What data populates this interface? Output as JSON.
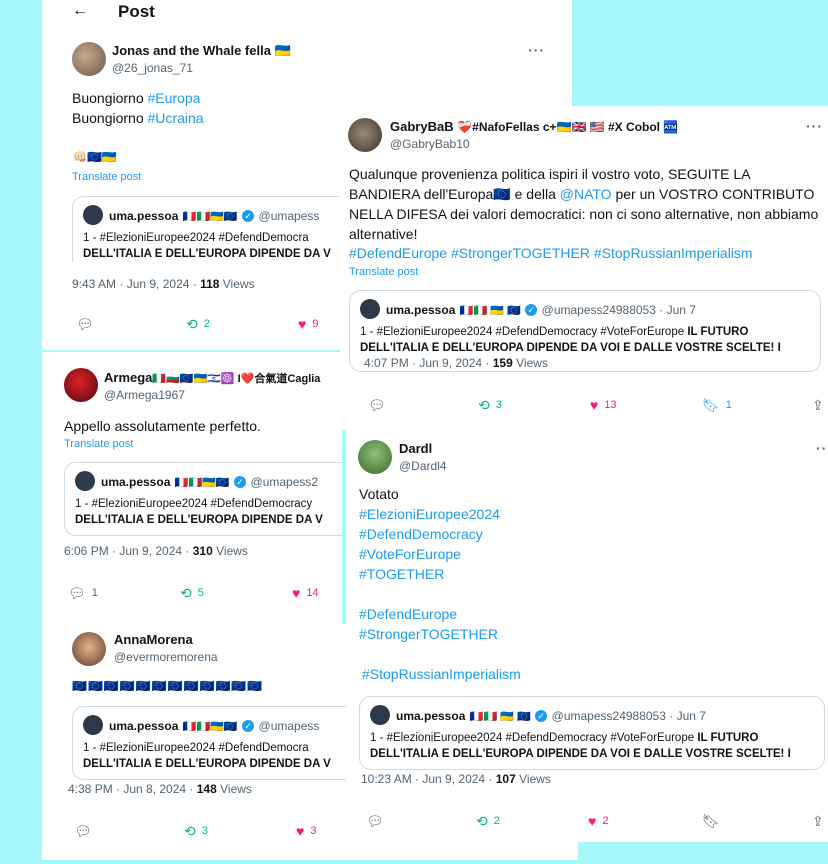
{
  "header": {
    "back_icon": "arrow-left-icon",
    "title": "Post"
  },
  "post1": {
    "author": "Jonas and the Whale fella",
    "author_flags": "🇺🇦",
    "handle": "@26_jonas_71",
    "line1_prefix": "Buongiorno ",
    "line1_tag": "#Europa",
    "line2_prefix": "Buongiorno ",
    "line2_tag": "#Ucraina",
    "emoji_line": "👊🏻🇪🇺🇺🇦",
    "translate": "Translate post",
    "quote": {
      "name": "uma.pessoa",
      "flags": "🇫🇷🇮🇹🇺🇦🇪🇺",
      "handle": "@umapess",
      "line1": "1 -  #ElezioniEuropee2024 #DefendDemocra",
      "line2": "DELL'ITALIA E DELL'EUROPA DIPENDE DA V"
    },
    "meta_time": "9:43 AM · Jun 9, 2024 · ",
    "views_num": "118",
    "views_label": " Views",
    "retweets": "2",
    "likes": "9"
  },
  "post2": {
    "author": "GabryBaB",
    "author_suffix": "❤️‍🩹#NafoFellas c+🇺🇦🇬🇧 🇺🇸 #X Cobol 🏧",
    "handle": "@GabryBab10",
    "text": "Qualunque provenienza politica ispiri il vostro voto, SEGUITE LA BANDIERA dell'Europa🇪🇺 e della ",
    "mention": "@NATO",
    "text2": " per un VOSTRO CONTRIBUTO NELLA DIFESA dei valori democratici: non ci sono alternative, non abbiamo alternative!",
    "tags": "#DefendEurope #StrongerTOGETHER #StopRussianImperialism",
    "translate": "Translate post",
    "quote": {
      "name": "uma.pessoa",
      "flags": "🇫🇷🇮🇹 🇺🇦 🇪🇺",
      "handle": "@umapess24988053 · Jun 7",
      "line1_plain": "1 -  #ElezioniEuropee2024 #DefendDemocracy #VoteForEurope ",
      "line1_bold": "IL FUTURO",
      "line2": "DELL'ITALIA E DELL'EUROPA DIPENDE DA VOI E DALLE VOSTRE SCELTE! I"
    },
    "meta_time": "4:07 PM · Jun 9, 2024 · ",
    "views_num": "159",
    "views_label": " Views",
    "retweets": "3",
    "likes": "13",
    "bookmarks": "1"
  },
  "post3": {
    "author": "Armega",
    "author_suffix": "🇮🇹🇧🇬🇪🇺🇺🇦🇮🇱☸️ I❤️合氣道Caglia",
    "handle": "@Armega1967",
    "text": "Appello assolutamente perfetto.",
    "translate": "Translate post",
    "quote": {
      "name": "uma.pessoa",
      "flags": "🇫🇷🇮🇹🇺🇦🇪🇺",
      "handle": "@umapess2",
      "line1": "1 -  #ElezioniEuropee2024 #DefendDemocracy",
      "line2": "DELL'ITALIA E DELL'EUROPA DIPENDE DA V"
    },
    "meta_time": "6:06 PM · Jun 9, 2024 · ",
    "views_num": "310",
    "views_label": " Views",
    "replies": "1",
    "retweets": "5",
    "likes": "14"
  },
  "post4": {
    "author": "Dardl",
    "handle": "@Dardl4",
    "line_votato": "Votato",
    "tags_a": [
      "#ElezioniEuropee2024",
      "#DefendDemocracy",
      "#VoteForEurope",
      "#TOGETHER"
    ],
    "tags_b": [
      "#DefendEurope",
      "#StrongerTOGETHER"
    ],
    "tag_c": "#StopRussianImperialism",
    "quote": {
      "name": "uma.pessoa",
      "flags": "🇫🇷🇮🇹 🇺🇦 🇪🇺",
      "handle": "@umapess24988053 · Jun 7",
      "line1_plain": "1 -  #ElezioniEuropee2024 #DefendDemocracy #VoteForEurope ",
      "line1_bold": "IL FUTURO",
      "line2": "DELL'ITALIA E DELL'EUROPA DIPENDE DA VOI E DALLE VOSTRE SCELTE! I"
    },
    "meta_time": "10:23 AM · Jun 9, 2024 · ",
    "views_num": "107",
    "views_label": " Views",
    "retweets": "2",
    "likes": "2"
  },
  "post5": {
    "author": "AnnaMorena",
    "handle": "@evermoremorena",
    "emoji_line": "🇪🇺🇪🇺🇪🇺🇪🇺🇪🇺🇪🇺🇪🇺🇪🇺🇪🇺🇪🇺🇪🇺🇪🇺",
    "quote": {
      "name": "uma.pessoa",
      "flags": "🇫🇷🇮🇹🇺🇦🇪🇺",
      "handle": "@umapess",
      "line1": "1 -  #ElezioniEuropee2024 #DefendDemocra",
      "line2": "DELL'ITALIA E DELL'EUROPA DIPENDE DA V"
    },
    "meta_time": "4:38 PM · Jun 8, 2024 · ",
    "views_num": "148",
    "views_label": " Views",
    "retweets": "3",
    "likes": "3"
  },
  "icons": {
    "reply": "speech-bubble-icon",
    "retweet": "retweet-icon",
    "like": "heart-icon",
    "bookmark": "bookmark-icon",
    "share": "share-icon",
    "more": "more-dots-icon",
    "verified": "verified-badge-icon"
  },
  "colors": {
    "accent": "#1d9bf0",
    "retweet": "#00ba7c",
    "like": "#f91880",
    "background": "#a5f7f9"
  }
}
